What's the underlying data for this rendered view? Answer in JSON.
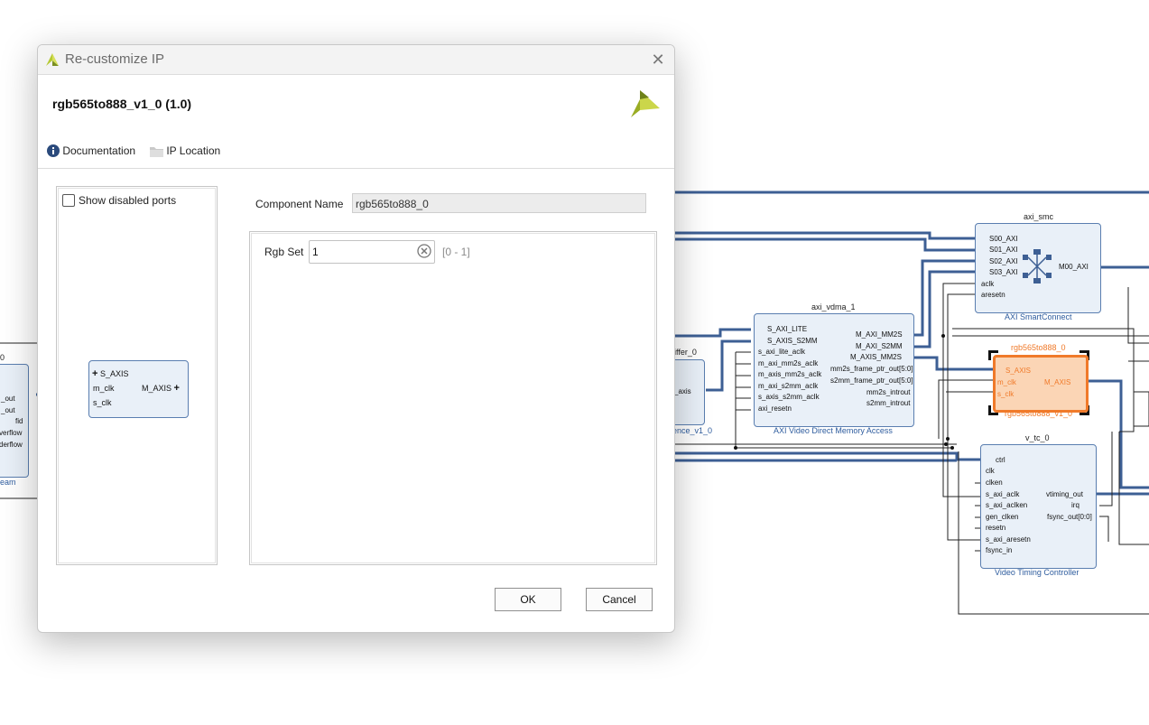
{
  "dialog": {
    "title": "Re-customize IP",
    "ip_name": "rgb565to888_v1_0 (1.0)",
    "toolbar": {
      "documentation": "Documentation",
      "ip_location": "IP Location"
    },
    "left_panel": {
      "show_disabled_ports": "Show disabled ports",
      "preview_ports": {
        "s_axis": "S_AXIS",
        "m_clk": "m_clk",
        "s_clk": "s_clk",
        "m_axis": "M_AXIS"
      }
    },
    "component_name_label": "Component Name",
    "component_name_value": "rgb565to888_0",
    "param_rgb_set_label": "Rgb Set",
    "param_rgb_set_value": "1",
    "param_rgb_set_range": "[0 - 1]",
    "ok_label": "OK",
    "cancel_label": "Cancel"
  },
  "diagram": {
    "left_block": {
      "name_partial": "0",
      "sub_partial": "eam",
      "ports": [
        "_out",
        "_out",
        "fid",
        "verflow",
        "derflow"
      ]
    },
    "buffer_block": {
      "name_partial": "iffer_0",
      "port": "_axis",
      "sub_partial": "ence_v1_0"
    },
    "axi_smc": {
      "name": "axi_smc",
      "subtitle": "AXI SmartConnect",
      "ports_in": [
        "S00_AXI",
        "S01_AXI",
        "S02_AXI",
        "S03_AXI",
        "aclk",
        "aresetn"
      ],
      "port_out": "M00_AXI"
    },
    "axi_vdma": {
      "name": "axi_vdma_1",
      "subtitle": "AXI Video Direct Memory Access",
      "ports_in": [
        "S_AXI_LITE",
        "S_AXIS_S2MM",
        "s_axi_lite_aclk",
        "m_axi_mm2s_aclk",
        "m_axis_mm2s_aclk",
        "m_axi_s2mm_aclk",
        "s_axis_s2mm_aclk",
        "axi_resetn"
      ],
      "ports_out": [
        "M_AXI_MM2S",
        "M_AXI_S2MM",
        "M_AXIS_MM2S",
        "mm2s_frame_ptr_out[5:0]",
        "s2mm_frame_ptr_out[5:0]",
        "mm2s_introut",
        "s2mm_introut"
      ]
    },
    "rgb_block": {
      "name": "rgb565to888_0",
      "subtitle": "rgb565to888_v1_0",
      "ports_in": [
        "S_AXIS",
        "m_clk",
        "s_clk"
      ],
      "port_out": "M_AXIS"
    },
    "vtc": {
      "name": "v_tc_0",
      "subtitle": "Video Timing Controller",
      "ports_in": [
        "ctrl",
        "clk",
        "clken",
        "s_axi_aclk",
        "s_axi_aclken",
        "gen_clken",
        "resetn",
        "s_axi_aresetn",
        "fsync_in"
      ],
      "ports_out": [
        "vtiming_out",
        "irq",
        "fsync_out[0:0]"
      ]
    },
    "colors": {
      "bus": "#3d5f94",
      "wire": "#222222",
      "block_fill": "#e9f0f8",
      "block_border": "#5a7eb0",
      "selected": "#f07a2a",
      "selected_fill": "#fbd5b5"
    }
  }
}
